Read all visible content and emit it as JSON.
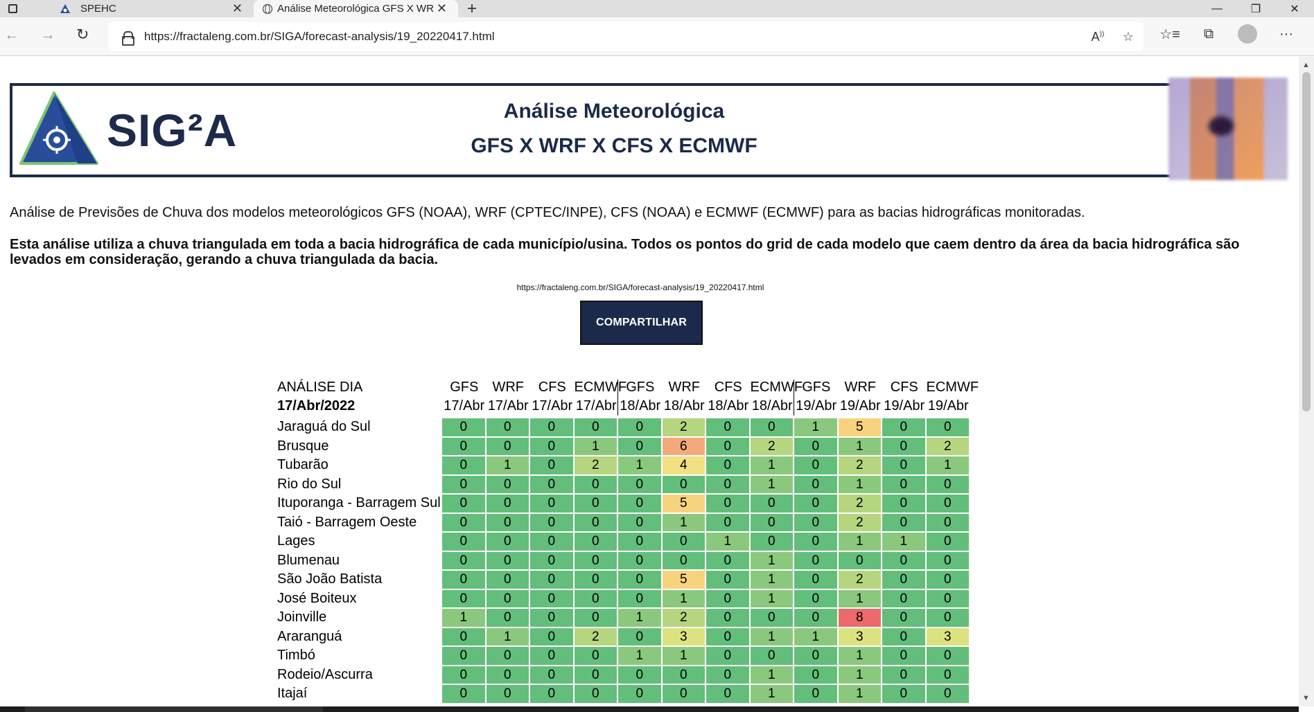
{
  "browser": {
    "tabs": [
      {
        "title": "SPEHC",
        "active": false
      },
      {
        "title": "Análise Meteorológica GFS X WR",
        "active": true
      }
    ],
    "url": "https://fractaleng.com.br/SIGA/forecast-analysis/19_20220417.html",
    "icons": {
      "back": "back-arrow-icon",
      "forward": "forward-arrow-icon",
      "reload": "reload-icon",
      "read_aloud": "read-aloud-icon",
      "favorite_add": "add-favorite-icon",
      "favorites": "favorites-icon",
      "collections": "collections-icon",
      "profile": "profile-avatar",
      "more": "more-menu-icon"
    }
  },
  "header": {
    "logo_text": "SIG²A",
    "title_line1": "Análise Meteorológica",
    "title_line2": "GFS X WRF X CFS X ECMWF"
  },
  "intro_text": "Análise de Previsões de Chuva dos modelos meteorológicos GFS (NOAA), WRF (CPTEC/INPE), CFS (NOAA) e ECMWF (ECMWF) para as bacias hidrográficas monitoradas.",
  "bold_note": "Esta análise utiliza a chuva triangulada em toda a bacia hidrográfica de cada município/usina. Todos os pontos do grid de cada modelo que caem dentro da área da bacia hidrográfica são levados em consideração, gerando a chuva triangulada da bacia.",
  "share_url": "https://fractaleng.com.br/SIGA/forecast-analysis/19_20220417.html",
  "share_button": "COMPARTILHAR",
  "table": {
    "analysis_label": "ANÁLISE DIA",
    "analysis_date": "17/Abr/2022",
    "columns": [
      {
        "model": "GFS",
        "date": "17/Abr"
      },
      {
        "model": "WRF",
        "date": "17/Abr"
      },
      {
        "model": "CFS",
        "date": "17/Abr"
      },
      {
        "model": "ECMWF",
        "date": "17/Abr"
      },
      {
        "model": "GFS",
        "date": "18/Abr"
      },
      {
        "model": "WRF",
        "date": "18/Abr"
      },
      {
        "model": "CFS",
        "date": "18/Abr"
      },
      {
        "model": "ECMWF",
        "date": "18/Abr"
      },
      {
        "model": "GFS",
        "date": "19/Abr"
      },
      {
        "model": "WRF",
        "date": "19/Abr"
      },
      {
        "model": "CFS",
        "date": "19/Abr"
      },
      {
        "model": "ECMWF",
        "date": "19/Abr"
      }
    ],
    "rows": [
      {
        "name": "Jaraguá do Sul",
        "values": [
          0,
          0,
          0,
          0,
          0,
          2,
          0,
          0,
          1,
          5,
          0,
          0
        ]
      },
      {
        "name": "Brusque",
        "values": [
          0,
          0,
          0,
          1,
          0,
          6,
          0,
          2,
          0,
          1,
          0,
          2
        ]
      },
      {
        "name": "Tubarão",
        "values": [
          0,
          1,
          0,
          2,
          1,
          4,
          0,
          1,
          0,
          2,
          0,
          1
        ]
      },
      {
        "name": "Rio do Sul",
        "values": [
          0,
          0,
          0,
          0,
          0,
          0,
          0,
          1,
          0,
          1,
          0,
          0
        ]
      },
      {
        "name": "Ituporanga - Barragem Sul",
        "values": [
          0,
          0,
          0,
          0,
          0,
          5,
          0,
          0,
          0,
          2,
          0,
          0
        ]
      },
      {
        "name": "Taió - Barragem Oeste",
        "values": [
          0,
          0,
          0,
          0,
          0,
          1,
          0,
          0,
          0,
          2,
          0,
          0
        ]
      },
      {
        "name": "Lages",
        "values": [
          0,
          0,
          0,
          0,
          0,
          0,
          1,
          0,
          0,
          1,
          1,
          0
        ]
      },
      {
        "name": "Blumenau",
        "values": [
          0,
          0,
          0,
          0,
          0,
          0,
          0,
          1,
          0,
          0,
          0,
          0
        ]
      },
      {
        "name": "São João Batista",
        "values": [
          0,
          0,
          0,
          0,
          0,
          5,
          0,
          1,
          0,
          2,
          0,
          0
        ]
      },
      {
        "name": "José Boiteux",
        "values": [
          0,
          0,
          0,
          0,
          0,
          1,
          0,
          1,
          0,
          1,
          0,
          0
        ]
      },
      {
        "name": "Joinville",
        "values": [
          1,
          0,
          0,
          0,
          1,
          2,
          0,
          0,
          0,
          8,
          0,
          0
        ]
      },
      {
        "name": "Araranguá",
        "values": [
          0,
          1,
          0,
          2,
          0,
          3,
          0,
          1,
          1,
          3,
          0,
          3
        ]
      },
      {
        "name": "Timbó",
        "values": [
          0,
          0,
          0,
          0,
          1,
          1,
          0,
          0,
          0,
          1,
          0,
          0
        ]
      },
      {
        "name": "Rodeio/Ascurra",
        "values": [
          0,
          0,
          0,
          0,
          0,
          0,
          0,
          1,
          0,
          1,
          0,
          0
        ]
      },
      {
        "name": "Itajaí",
        "values": [
          0,
          0,
          0,
          0,
          0,
          0,
          0,
          1,
          0,
          1,
          0,
          0
        ]
      }
    ],
    "color_scale": {
      "0": "#63be7b",
      "1": "#8ac97d",
      "2": "#b5d67f",
      "3": "#dce27f",
      "4": "#f2e083",
      "5": "#f7d37f",
      "6": "#f4a97a",
      "8": "#ec6a6c"
    }
  }
}
